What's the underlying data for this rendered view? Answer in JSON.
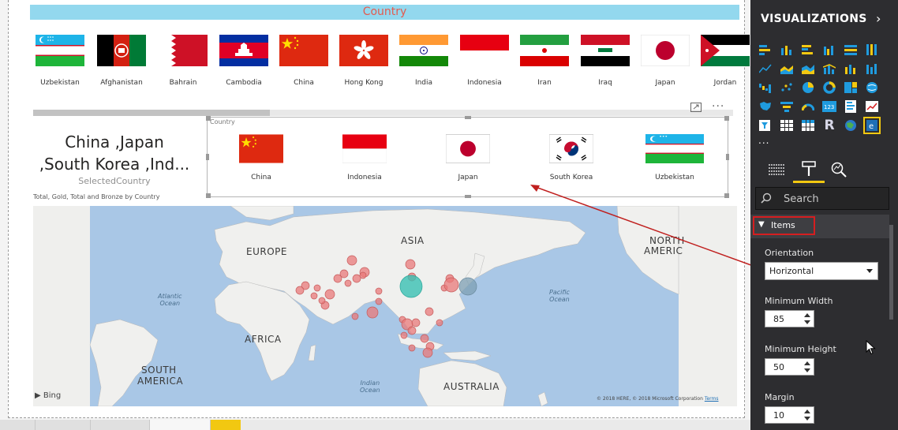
{
  "top_slicer": {
    "header": "Country",
    "items": [
      {
        "label": "Uzbekistan",
        "flag": "uzbekistan-flag-icon"
      },
      {
        "label": "Afghanistan",
        "flag": "afghanistan-flag-icon"
      },
      {
        "label": "Bahrain",
        "flag": "bahrain-flag-icon"
      },
      {
        "label": "Cambodia",
        "flag": "cambodia-flag-icon"
      },
      {
        "label": "China",
        "flag": "china-flag-icon"
      },
      {
        "label": "Hong Kong",
        "flag": "hong-kong-flag-icon"
      },
      {
        "label": "India",
        "flag": "india-flag-icon"
      },
      {
        "label": "Indonesia",
        "flag": "indonesia-flag-icon"
      },
      {
        "label": "Iran",
        "flag": "iran-flag-icon"
      },
      {
        "label": "Iraq",
        "flag": "iraq-flag-icon"
      },
      {
        "label": "Japan",
        "flag": "japan-flag-icon"
      },
      {
        "label": "Jordan",
        "flag": "jordan-flag-icon"
      }
    ]
  },
  "card": {
    "value_line1": "China ,Japan",
    "value_line2": ",South Korea ,Ind...",
    "label": "SelectedCountry"
  },
  "selected_slicer": {
    "title": "Country",
    "items": [
      {
        "label": "China",
        "flag": "china-flag-icon"
      },
      {
        "label": "Indonesia",
        "flag": "indonesia-flag-icon"
      },
      {
        "label": "Japan",
        "flag": "japan-flag-icon"
      },
      {
        "label": "South Korea",
        "flag": "south-korea-flag-icon"
      },
      {
        "label": "Uzbekistan",
        "flag": "uzbekistan-flag-icon"
      }
    ]
  },
  "map": {
    "title": "Total, Gold, Total and Bronze by Country",
    "labels": {
      "asia": "ASIA",
      "europe": "EUROPE",
      "africa": "AFRICA",
      "south_america_1": "SOUTH",
      "south_america_2": "AMERICA",
      "north_america_1": "NORTH",
      "north_america_2": "AMERIC",
      "australia": "AUSTRALIA"
    },
    "oceans": {
      "atlantic_1": "Atlantic",
      "atlantic_2": "Ocean",
      "pacific_1": "Pacific",
      "pacific_2": "Ocean",
      "indian_1": "Indian",
      "indian_2": "Ocean"
    },
    "attribution": "Bing",
    "copyright": "© 2018 HERE, © 2018 Microsoft Corporation",
    "terms": "Terms",
    "colors": {
      "water": "#a9c7e6",
      "land": "#f0f0ee",
      "red_bubble": "#e97a7a",
      "teal_bubble": "#39c0b3",
      "gray_bubble": "#7e9fb3"
    }
  },
  "visualizations_pane": {
    "title": "VISUALIZATIONS",
    "more": "...",
    "search_placeholder": "Search",
    "section": "Items",
    "orientation_label": "Orientation",
    "orientation_value": "Horizontal",
    "min_width_label": "Minimum Width",
    "min_width_value": "85",
    "min_height_label": "Minimum Height",
    "min_height_value": "50",
    "margin_label": "Margin",
    "margin_value": "10",
    "accent": "#f2c811"
  }
}
